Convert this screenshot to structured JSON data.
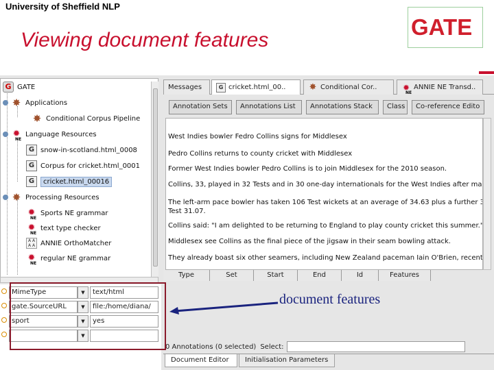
{
  "slide": {
    "org_title": "University of Sheffield NLP",
    "title": "Viewing document features",
    "logo_text": "GATE",
    "annotation_label": "document features"
  },
  "tree": {
    "root": "GATE",
    "items": [
      {
        "label": "Applications",
        "icon": "gear-icon",
        "level": 1
      },
      {
        "label": "Conditional Corpus Pipeline",
        "icon": "gear-icon",
        "level": 2
      },
      {
        "label": "Language Resources",
        "icon": "ne-icon",
        "level": 1
      },
      {
        "label": "snow-in-scotland.html_0008",
        "icon": "document-icon",
        "level": 2
      },
      {
        "label": "Corpus for cricket.html_0001",
        "icon": "corpus-icon",
        "level": 2
      },
      {
        "label": "cricket.html_00016",
        "icon": "document-icon",
        "level": 2,
        "selected": true
      },
      {
        "label": "Processing Resources",
        "icon": "gear-icon",
        "level": 1
      },
      {
        "label": "Sports NE grammar",
        "icon": "ne-icon",
        "level": 2
      },
      {
        "label": "text type checker",
        "icon": "ne-icon",
        "level": 2
      },
      {
        "label": "ANNIE OrthoMatcher",
        "icon": "aa-icon",
        "level": 2
      },
      {
        "label": "regular NE grammar",
        "icon": "ne-icon",
        "level": 2
      }
    ]
  },
  "features": [
    {
      "name": "MimeType",
      "value": "text/html"
    },
    {
      "name": "gate.SourceURL",
      "value": "file:/home/diana/"
    },
    {
      "name": "sport",
      "value": "yes"
    },
    {
      "name": "",
      "value": ""
    }
  ],
  "tabs": [
    {
      "label": "Messages",
      "icon": "",
      "active": false
    },
    {
      "label": "cricket.html_00..",
      "icon": "document-icon",
      "active": true
    },
    {
      "label": "Conditional Cor..",
      "icon": "gear-icon",
      "active": false
    },
    {
      "label": "ANNIE NE Transd..",
      "icon": "ne-icon",
      "active": false
    }
  ],
  "view_buttons": [
    "Annotation Sets",
    "Annotations List",
    "Annotations Stack",
    "Class",
    "Co-reference Edito"
  ],
  "document_paragraphs": [
    "West Indies bowler Fedro Collins signs for Middlesex",
    "Pedro Collins returns to county cricket with Middlesex",
    "Former West Indies bowler Pedro Collins is to join Middlesex for the 2010 season.",
    "Collins, 33, played in 32 Tests and in 30 one-day internationals for the West Indies after making",
    "The left-arm pace bowler has taken 106 Test wickets at an average of 34.63 plus a further 3",
    "Test 31.07.",
    "Collins said: \"I am delighted to be returning to England to play county cricket this summer.\"",
    "Middlesex see Collins as the final piece of the jigsaw in their seam bowling attack.",
    "They already boast six other seamers, including New Zealand paceman Iain O'Brien, recent En"
  ],
  "annotation_columns": [
    "Type",
    "Set",
    "Start",
    "End",
    "Id",
    "Features"
  ],
  "annotations_status": "0 Annotations (0 selected)",
  "select_label": "Select:",
  "bottom_tabs": [
    "Document Editor",
    "Initialisation Parameters"
  ],
  "colors": {
    "title_red": "#c8102e",
    "highlight_box": "#8b1a2b",
    "label_blue": "#1a237e"
  }
}
